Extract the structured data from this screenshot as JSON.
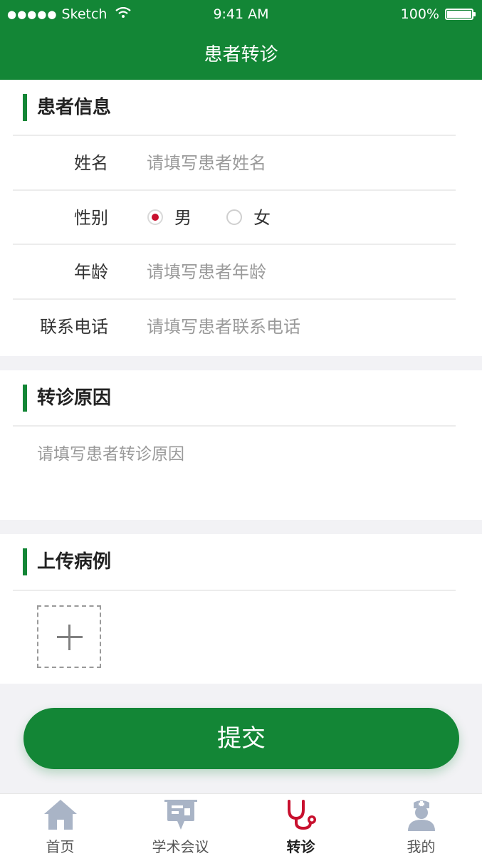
{
  "status_bar": {
    "carrier": "Sketch",
    "signal_dots": "●●●●●",
    "time": "9:41 AM",
    "battery": "100%"
  },
  "nav": {
    "title": "患者转诊"
  },
  "patient_info": {
    "title": "患者信息",
    "fields": [
      {
        "label": "姓名",
        "placeholder": "请填写患者姓名"
      },
      {
        "label": "年龄",
        "placeholder": "请填写患者年龄"
      },
      {
        "label": "联系电话",
        "placeholder": "请填写患者联系电话"
      }
    ],
    "gender": {
      "label": "性别",
      "options": [
        {
          "label": "男",
          "selected": true
        },
        {
          "label": "女",
          "selected": false
        }
      ]
    }
  },
  "reason": {
    "title": "转诊原因",
    "placeholder": "请填写患者转诊原因"
  },
  "upload": {
    "title": "上传病例",
    "add_icon": "plus-icon"
  },
  "submit_label": "提交",
  "tabbar": {
    "items": [
      {
        "label": "首页",
        "icon": "home-icon",
        "active": false
      },
      {
        "label": "学术会议",
        "icon": "presentation-board-icon",
        "active": false
      },
      {
        "label": "转诊",
        "icon": "stethoscope-icon",
        "active": true
      },
      {
        "label": "我的",
        "icon": "nurse-avatar-icon",
        "active": false
      }
    ]
  },
  "colors": {
    "primary": "#138636",
    "accent_red": "#c8102e",
    "tab_icon_inactive": "#a9b4c6"
  }
}
